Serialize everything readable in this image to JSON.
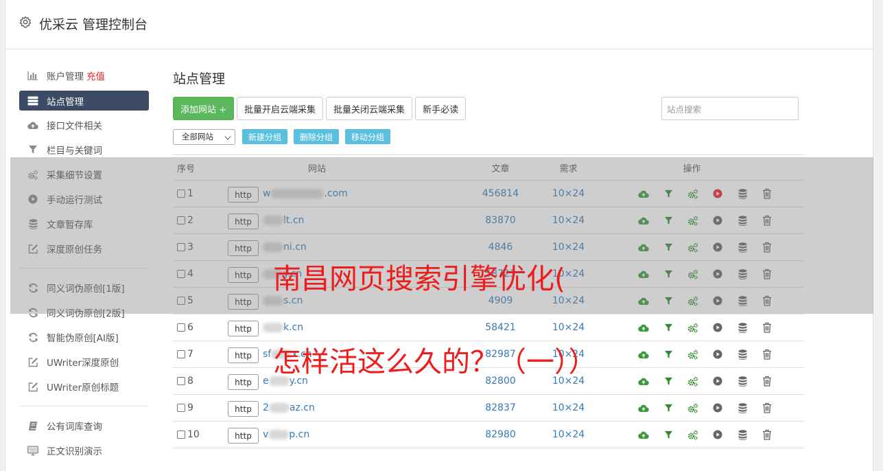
{
  "header": {
    "title": "优采云 管理控制台"
  },
  "sidebar": {
    "group1": [
      {
        "label": "账户管理",
        "extra": "充值",
        "icon": "bar-chart-icon"
      },
      {
        "label": "站点管理",
        "icon": "server-icon",
        "active": true
      },
      {
        "label": "接口文件相关",
        "icon": "cloud-upload-icon"
      },
      {
        "label": "栏目与关键词",
        "icon": "filter-icon"
      },
      {
        "label": "采集细节设置",
        "icon": "cogs-icon"
      },
      {
        "label": "手动运行测试",
        "icon": "play-circle-icon"
      },
      {
        "label": "文章暂存库",
        "icon": "database-icon"
      },
      {
        "label": "深度原创任务",
        "icon": "edit-icon"
      }
    ],
    "group2": [
      {
        "label": "同义词伪原创[1版]",
        "icon": "refresh-icon"
      },
      {
        "label": "同义词伪原创[2版]",
        "icon": "refresh-icon"
      },
      {
        "label": "智能伪原创[AI版]",
        "icon": "refresh-icon"
      },
      {
        "label": "UWriter深度原创",
        "icon": "edit-icon"
      },
      {
        "label": "UWriter原创标题",
        "icon": "edit-icon"
      }
    ],
    "group3": [
      {
        "label": "公有词库查询",
        "icon": "book-icon"
      },
      {
        "label": "正文识别演示",
        "icon": "monitor-icon"
      }
    ]
  },
  "main": {
    "title": "站点管理",
    "toolbar": {
      "add_site": "添加网站 +",
      "batch_open": "批量开启云端采集",
      "batch_close": "批量关闭云端采集",
      "newbie": "新手必读",
      "search_placeholder": "站点搜索"
    },
    "group_select": "全部网站",
    "group_buttons": {
      "new": "新建分组",
      "delete": "删除分组",
      "move": "移动分组"
    },
    "table": {
      "headers": {
        "index": "序号",
        "site": "网站",
        "articles": "文章",
        "demand": "需求",
        "ops": "操作"
      },
      "http_label": "http",
      "rows": [
        {
          "index": "1",
          "prefix": "w",
          "suffix": ".com",
          "articles": "456814",
          "demand": "10×24",
          "play_red": true
        },
        {
          "index": "2",
          "prefix": "",
          "suffix": "lt.cn",
          "articles": "83870",
          "demand": "10×24"
        },
        {
          "index": "3",
          "prefix": "",
          "suffix": "ni.cn",
          "articles": "4846",
          "demand": "10×24"
        },
        {
          "index": "4",
          "prefix": "",
          "suffix": "y.cn",
          "articles": "58723",
          "demand": "10×24"
        },
        {
          "index": "5",
          "prefix": "",
          "suffix": "s.cn",
          "articles": "4909",
          "demand": "10×24"
        },
        {
          "index": "6",
          "prefix": "",
          "suffix": "k.cn",
          "articles": "58421",
          "demand": "10×24"
        },
        {
          "index": "7",
          "prefix": "sf",
          "suffix": "x.cn",
          "articles": "82987",
          "demand": "10×24"
        },
        {
          "index": "8",
          "prefix": "e",
          "suffix": "y.cn",
          "articles": "82800",
          "demand": "10×24"
        },
        {
          "index": "9",
          "prefix": "2",
          "suffix": "az.cn",
          "articles": "82837",
          "demand": "10×24"
        },
        {
          "index": "10",
          "prefix": "v",
          "suffix": "p.cn",
          "articles": "82980",
          "demand": "10×24"
        }
      ]
    }
  },
  "overlay": {
    "line1": "南昌网页搜索引擎优化(",
    "line2": "怎样活这么久的？（一））"
  },
  "colors": {
    "accent_green": "#5cb85c",
    "sidebar_active": "#3c4a63",
    "link_blue": "#337ab7",
    "info_blue": "#5bc0de",
    "banner_red": "#ee1c1c"
  }
}
